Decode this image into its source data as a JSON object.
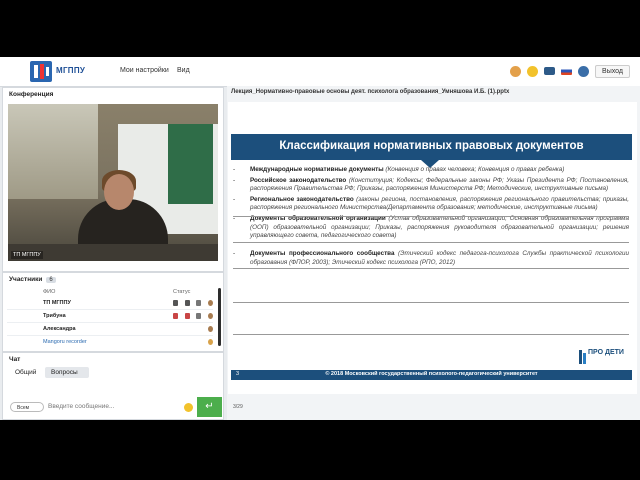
{
  "app": {
    "logo_text": "МГППУ",
    "menu": [
      "Мои настройки",
      "Вид"
    ],
    "exit_label": "Выход"
  },
  "conference": {
    "title": "Конференция",
    "video_caption": "ТП МГППУ"
  },
  "participants": {
    "title": "Участники",
    "count": "6",
    "col_name": "ФИО",
    "col_status": "Статус",
    "rows": [
      {
        "name": "ТП МГППУ"
      },
      {
        "name": "Трибуна"
      },
      {
        "name": "Александра"
      },
      {
        "name": "Mangoru recorder"
      }
    ]
  },
  "chat": {
    "title": "Чат",
    "tabs": [
      "Общий",
      "Вопросы"
    ],
    "recipient": "Всем",
    "placeholder": "Введите сообщение..."
  },
  "presentation": {
    "file_title": "Лекция_Нормативно-правовые основы деят. психолога образования_Умняшова И.Б. (1).pptx",
    "slide_title": "Классификация нормативных правовых документов",
    "items": [
      {
        "bold": "Международные нормативные документы",
        "rest": "(Конвенция о правах человека; Конвенция о правах ребенка)"
      },
      {
        "bold": "Российское законодательство",
        "rest": "(Конституция; Кодексы; Федеральные законы РФ; Указы Президента РФ; Постановления, распоряжения Правительства РФ; Приказы, распоряжения Министерств РФ; Методические, инструктивные письма)"
      },
      {
        "bold": "Региональное законодательство",
        "rest": "(законы региона, постановления, распоряжения регионального правительства; приказы, распоряжения регионального Министерства/Департамента образования; методические, инструктивные письма)"
      },
      {
        "bold": "Документы образовательной организации",
        "rest": "(Устав образовательной организации; Основная образовательная программа (ООП) образовательной организации; Приказы, распоряжения руководителя образовательной организации; решения управляющего совета, педагогического совета)"
      },
      {
        "bold": "Документы профессионального сообщества",
        "rest": "(Этический кодекс педагога-психолога Службы практической психологии образования (ФПОР, 2003); Этический кодекс психолога (РПО, 2012)"
      }
    ],
    "footer": "© 2018 Московский государственный психолого-педагогический университет",
    "slide_number": "3",
    "brand": "ПРО ДЕТИ",
    "page_indicator": "3/29"
  }
}
